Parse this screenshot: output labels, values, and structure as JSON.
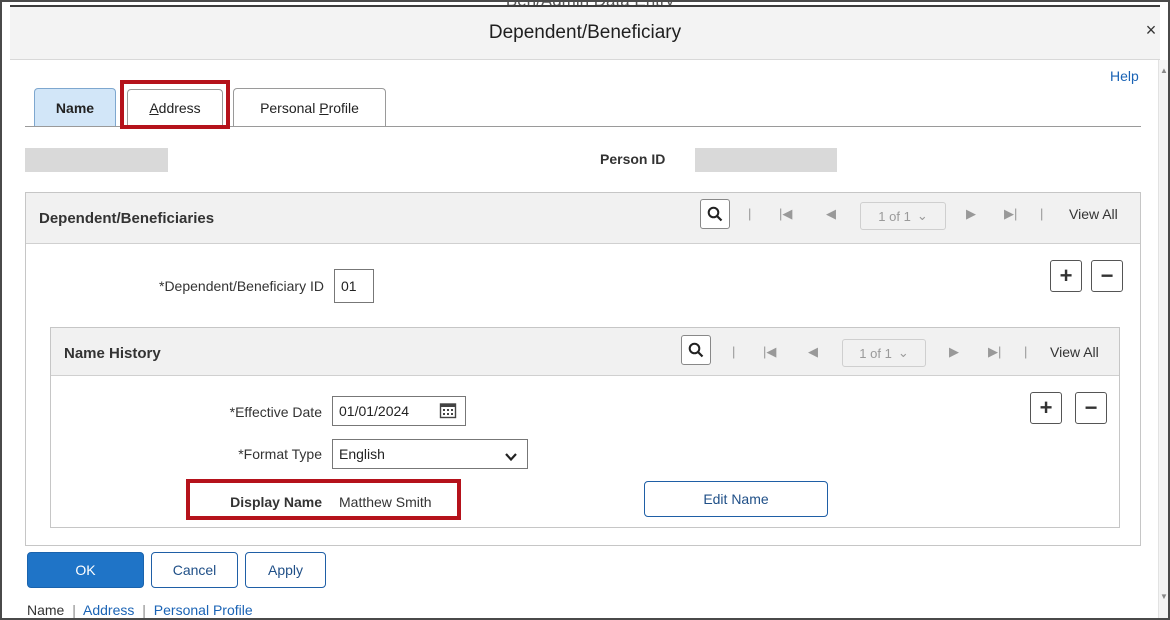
{
  "window": {
    "behind_title": "Ben/Admin Data Entry"
  },
  "modal": {
    "title": "Dependent/Beneficiary",
    "close_symbol": "×",
    "help": "Help"
  },
  "tabs": [
    {
      "label_underline": "N",
      "label_rest": "ame",
      "active": true
    },
    {
      "label_underline": "A",
      "label_rest": "ddress",
      "active": false,
      "highlighted": true
    },
    {
      "label_prefix": "Personal ",
      "label_underline": "P",
      "label_rest": "rofile",
      "active": false
    }
  ],
  "person": {
    "person_id_label": "Person ID"
  },
  "dependents_panel": {
    "title": "Dependent/Beneficiaries",
    "pager": "1 of 1",
    "view_all": "View All",
    "id_label": "*Dependent/Beneficiary ID",
    "id_value": "01"
  },
  "name_history_panel": {
    "title": "Name History",
    "pager": "1 of 1",
    "view_all": "View All",
    "effective_date_label": "*Effective Date",
    "effective_date_value": "01/01/2024",
    "format_type_label": "*Format Type",
    "format_type_value": "English",
    "display_name_label": "Display Name",
    "display_name_value": "Matthew Smith",
    "edit_name_button": "Edit Name"
  },
  "footer_buttons": {
    "ok": "OK",
    "cancel": "Cancel",
    "apply": "Apply"
  },
  "bottom_links": {
    "name": "Name",
    "address": "Address",
    "personal_profile": "Personal Profile",
    "separator": "|"
  },
  "colors": {
    "accent": "#1f74c7",
    "highlight": "#b5121b",
    "active_tab": "#d2e6f8"
  }
}
